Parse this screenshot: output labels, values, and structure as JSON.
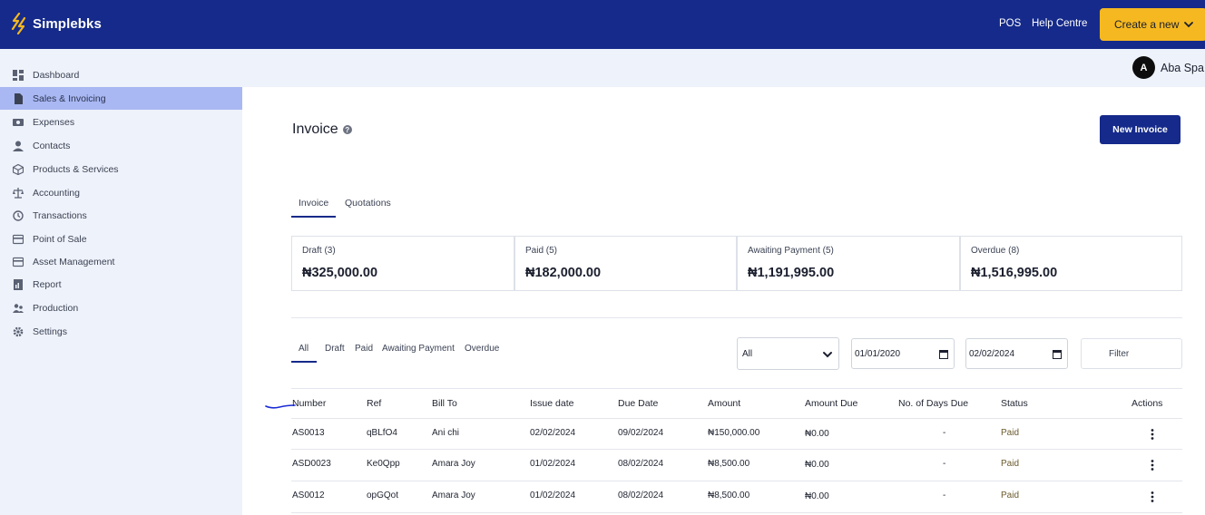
{
  "app": {
    "name": "Simplebks"
  },
  "header": {
    "pos_label": "POS",
    "help_label": "Help Centre",
    "create_label": "Create a new"
  },
  "user": {
    "initial": "A",
    "name": "Aba Spa"
  },
  "sidebar": {
    "active_index": 1,
    "items": [
      {
        "label": "Dashboard",
        "icon": "dashboard-icon"
      },
      {
        "label": "Sales & Invoicing",
        "icon": "invoice-icon"
      },
      {
        "label": "Expenses",
        "icon": "cash-icon"
      },
      {
        "label": "Contacts",
        "icon": "person-icon"
      },
      {
        "label": "Products & Services",
        "icon": "box-icon"
      },
      {
        "label": "Accounting",
        "icon": "scale-icon"
      },
      {
        "label": "Transactions",
        "icon": "history-icon"
      },
      {
        "label": "Point of Sale",
        "icon": "card-icon"
      },
      {
        "label": "Asset Management",
        "icon": "card-icon"
      },
      {
        "label": "Report",
        "icon": "report-icon"
      },
      {
        "label": "Production",
        "icon": "team-icon"
      },
      {
        "label": "Settings",
        "icon": "gear-icon"
      }
    ]
  },
  "page": {
    "title": "Invoice",
    "help_glyph": "?",
    "new_invoice_label": "New Invoice"
  },
  "tabs": [
    {
      "label": "Invoice",
      "active": true
    },
    {
      "label": "Quotations",
      "active": false
    }
  ],
  "summary_cards": [
    {
      "label": "Draft (3)",
      "value": "₦325,000.00"
    },
    {
      "label": "Paid (5)",
      "value": "₦182,000.00"
    },
    {
      "label": "Awaiting Payment (5)",
      "value": "₦1,191,995.00"
    },
    {
      "label": "Overdue (8)",
      "value": "₦1,516,995.00"
    }
  ],
  "filter_tabs": [
    "All",
    "Draft",
    "Paid",
    "Awaiting Payment",
    "Overdue"
  ],
  "filters": {
    "status_value": "All",
    "from_date": "01/01/2020",
    "to_date": "02/02/2024",
    "filter_label": "Filter"
  },
  "table": {
    "headers": [
      "Number",
      "Ref",
      "Bill To",
      "Issue date",
      "Due Date",
      "Amount",
      "Amount Due",
      "No. of Days Due",
      "Status",
      "Actions"
    ],
    "rows": [
      {
        "number": "AS0013",
        "ref": "qBLfO4",
        "bill_to": "Ani chi",
        "issue_date": "02/02/2024",
        "due_date": "09/02/2024",
        "amount": "₦150,000.00",
        "amount_due": "₦0.00",
        "days_due": "-",
        "status": "Paid"
      },
      {
        "number": "ASD0023",
        "ref": "Ke0Qpp",
        "bill_to": "Amara Joy",
        "issue_date": "01/02/2024",
        "due_date": "08/02/2024",
        "amount": "₦8,500.00",
        "amount_due": "₦0.00",
        "days_due": "-",
        "status": "Paid"
      },
      {
        "number": "AS0012",
        "ref": "opGQot",
        "bill_to": "Amara Joy",
        "issue_date": "01/02/2024",
        "due_date": "08/02/2024",
        "amount": "₦8,500.00",
        "amount_due": "₦0.00",
        "days_due": "-",
        "status": "Paid"
      }
    ]
  },
  "colors": {
    "brand": "#152a8a",
    "accent": "#f5b820",
    "sidebar_bg": "#eef2fa",
    "active_nav": "#a9b8f3"
  }
}
